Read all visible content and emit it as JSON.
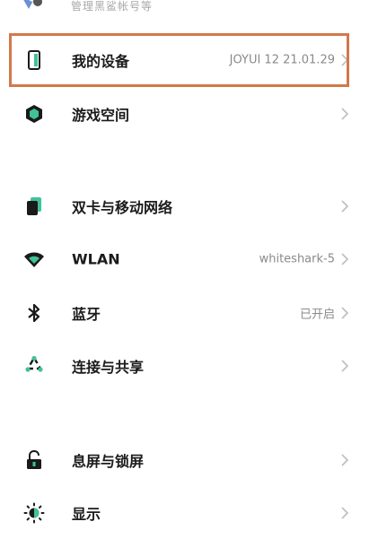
{
  "top_fragment": {
    "text": "管理黑鲨帐号等"
  },
  "items": [
    {
      "label": "我的设备",
      "value": "JOYUI 12 21.01.29",
      "icon": "phone-icon"
    },
    {
      "label": "游戏空间",
      "value": "",
      "icon": "game-space-icon"
    },
    {
      "label": "双卡与移动网络",
      "value": "",
      "icon": "sim-card-icon"
    },
    {
      "label": "WLAN",
      "value": "whiteshark-5",
      "icon": "wifi-icon"
    },
    {
      "label": "蓝牙",
      "value": "已开启",
      "icon": "bluetooth-icon"
    },
    {
      "label": "连接与共享",
      "value": "",
      "icon": "connection-share-icon"
    },
    {
      "label": "息屏与锁屏",
      "value": "",
      "icon": "lock-icon"
    },
    {
      "label": "显示",
      "value": "",
      "icon": "display-brightness-icon"
    }
  ],
  "colors": {
    "highlight_border": "#d3784a",
    "icon_primary": "#1a1a1a",
    "icon_accent": "#3fc29a",
    "value_text": "#8a8a8a",
    "chevron": "#bdbdbd"
  }
}
